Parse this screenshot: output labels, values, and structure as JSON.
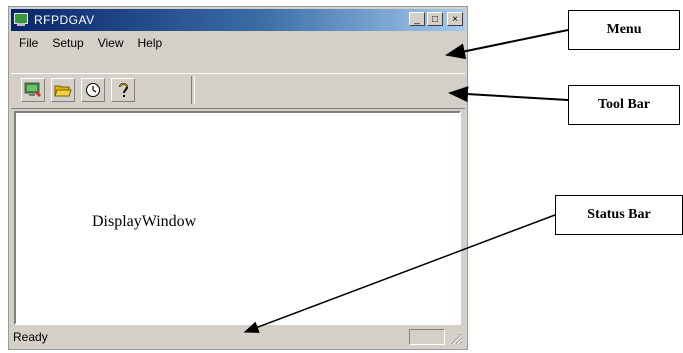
{
  "window": {
    "title": "RFPDGAV",
    "controls": {
      "minimize": "_",
      "maximize": "□",
      "close": "×"
    }
  },
  "menu": {
    "items": [
      "File",
      "Setup",
      "View",
      "Help"
    ]
  },
  "toolbar": {
    "buttons": [
      {
        "name": "monitor-icon"
      },
      {
        "name": "open-folder-icon"
      },
      {
        "name": "clock-icon"
      },
      {
        "name": "help-icon"
      }
    ]
  },
  "display": {
    "label": "DisplayWindow"
  },
  "statusbar": {
    "text": "Ready"
  },
  "annotations": {
    "menu": "Menu",
    "toolbar": "Tool Bar",
    "statusbar": "Status Bar"
  }
}
